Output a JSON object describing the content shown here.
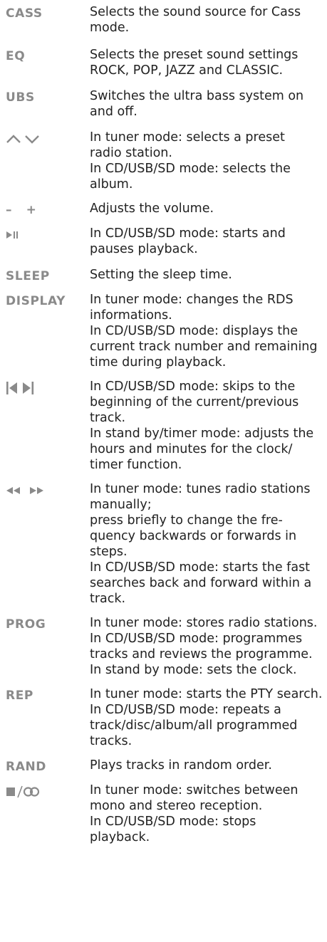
{
  "entries": [
    {
      "key": "CASS",
      "lines": [
        "Selects the sound source for Cass",
        "mode."
      ]
    },
    {
      "key": "EQ",
      "lines": [
        "Selects the preset sound settings",
        "ROCK, POP, JAZZ and CLASSIC."
      ]
    },
    {
      "key": "UBS",
      "lines": [
        "Switches the ultra bass system on",
        "and off."
      ]
    },
    {
      "key_icon": "chevron-up-down-icon",
      "lines": [
        "In tuner mode: selects a preset",
        "radio station.",
        "In CD/USB/SD mode: selects the",
        "album."
      ]
    },
    {
      "key": "–   +",
      "lines": [
        "Adjusts the volume."
      ]
    },
    {
      "key_icon": "play-pause-icon",
      "lines": [
        "In CD/USB/SD mode: starts and",
        "pauses playback."
      ]
    },
    {
      "key": "SLEEP",
      "lines": [
        "Setting the sleep time."
      ]
    },
    {
      "key": "DISPLAY",
      "lines": [
        "In tuner mode: changes the RDS",
        "informations.",
        "In CD/USB/SD mode: displays the",
        "current track number and remaining",
        "time during playback."
      ]
    },
    {
      "key_icon": "skip-back-forward-icon",
      "lines": [
        "In CD/USB/SD mode: skips to the",
        "beginning of the current/previous",
        "track.",
        "In stand by/timer mode: adjusts the",
        "hours and minutes for the clock/",
        "timer function."
      ]
    },
    {
      "key_icon": "rewind-fast-forward-icon",
      "lines": [
        "In tuner mode: tunes radio stations",
        "manually;",
        "press briefly to change the fre-",
        "quency backwards or forwards in",
        "steps.",
        "In CD/USB/SD mode: starts the fast",
        "searches back and forward within a",
        "track."
      ]
    },
    {
      "key": "PROG",
      "lines": [
        "In tuner mode: stores radio stations.",
        "In CD/USB/SD mode: programmes",
        "tracks and reviews the programme.",
        "In stand by mode: sets the clock."
      ]
    },
    {
      "key": "REP",
      "lines": [
        "In tuner mode: starts the PTY search.",
        "In CD/USB/SD mode: repeats a",
        "track/disc/album/all programmed",
        "tracks."
      ]
    },
    {
      "key": "RAND",
      "lines": [
        "Plays tracks in random order."
      ]
    },
    {
      "key_icon": "stop-stereo-icon",
      "lines": [
        "In tuner mode: switches between",
        "mono and stereo reception.",
        "In CD/USB/SD mode: stops",
        "playback."
      ]
    }
  ],
  "colors": {
    "key_text": "#8a8a8a",
    "body_text": "#222222",
    "icon": "#8a8a8a"
  }
}
